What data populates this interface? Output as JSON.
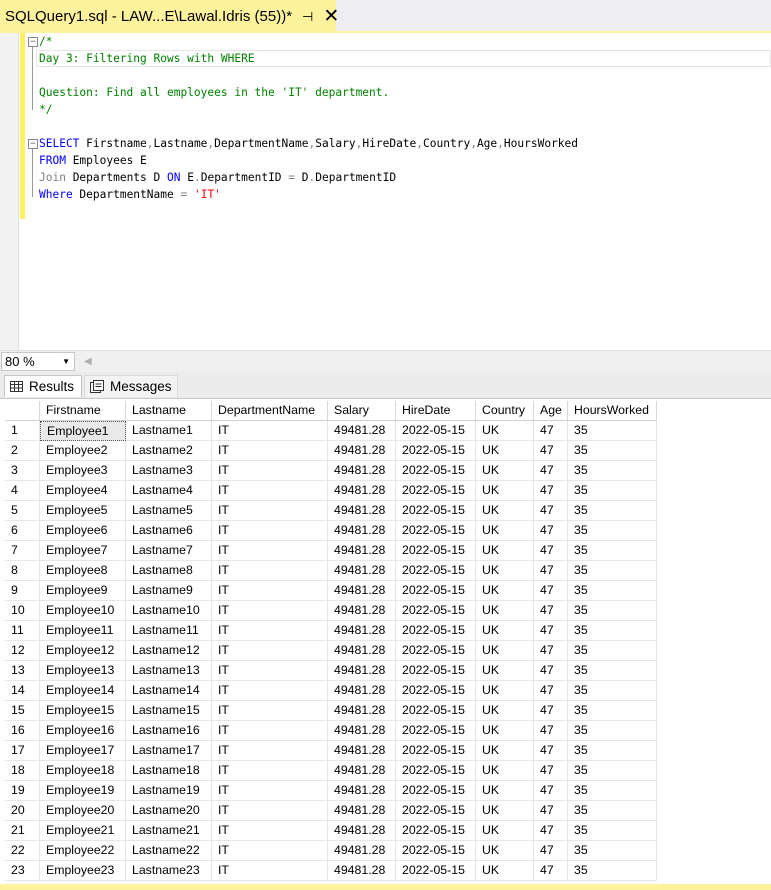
{
  "tab": {
    "title": "SQLQuery1.sql - LAW...E\\Lawal.Idris (55))*",
    "pin": "⊣",
    "close": "✕"
  },
  "editor": {
    "lines": [
      {
        "parts": [
          {
            "t": "/*",
            "c": "cm"
          }
        ]
      },
      {
        "parts": [
          {
            "t": "Day 3: Filtering Rows with WHERE",
            "c": "cm"
          }
        ]
      },
      {
        "parts": [
          {
            "t": "",
            "c": ""
          }
        ]
      },
      {
        "parts": [
          {
            "t": "Question: Find all employees in the 'IT' department.",
            "c": "cm"
          }
        ]
      },
      {
        "parts": [
          {
            "t": "*/",
            "c": "cm"
          }
        ]
      },
      {
        "parts": [
          {
            "t": "",
            "c": ""
          }
        ]
      },
      {
        "parts": [
          {
            "t": "SELECT",
            "c": "kw"
          },
          {
            "t": " Firstname",
            "c": ""
          },
          {
            "t": ",",
            "c": "gr"
          },
          {
            "t": "Lastname",
            "c": ""
          },
          {
            "t": ",",
            "c": "gr"
          },
          {
            "t": "DepartmentName",
            "c": ""
          },
          {
            "t": ",",
            "c": "gr"
          },
          {
            "t": "Salary",
            "c": ""
          },
          {
            "t": ",",
            "c": "gr"
          },
          {
            "t": "HireDate",
            "c": ""
          },
          {
            "t": ",",
            "c": "gr"
          },
          {
            "t": "Country",
            "c": ""
          },
          {
            "t": ",",
            "c": "gr"
          },
          {
            "t": "Age",
            "c": ""
          },
          {
            "t": ",",
            "c": "gr"
          },
          {
            "t": "HoursWorked",
            "c": ""
          }
        ]
      },
      {
        "parts": [
          {
            "t": "FROM",
            "c": "kw"
          },
          {
            "t": " Employees E",
            "c": ""
          }
        ]
      },
      {
        "parts": [
          {
            "t": "Join",
            "c": "gr"
          },
          {
            "t": " Departments D ",
            "c": ""
          },
          {
            "t": "ON",
            "c": "kw"
          },
          {
            "t": " E",
            "c": ""
          },
          {
            "t": ".",
            "c": "gr"
          },
          {
            "t": "DepartmentID ",
            "c": ""
          },
          {
            "t": "=",
            "c": "gr"
          },
          {
            "t": " D",
            "c": ""
          },
          {
            "t": ".",
            "c": "gr"
          },
          {
            "t": "DepartmentID",
            "c": ""
          }
        ]
      },
      {
        "parts": [
          {
            "t": "Where",
            "c": "kw"
          },
          {
            "t": " DepartmentName ",
            "c": ""
          },
          {
            "t": "=",
            "c": "gr"
          },
          {
            "t": " ",
            "c": ""
          },
          {
            "t": "'IT'",
            "c": "str"
          }
        ]
      }
    ]
  },
  "zoom": {
    "value": "80 %"
  },
  "results_tabs": {
    "results": "Results",
    "messages": "Messages"
  },
  "grid": {
    "columns": [
      "",
      "Firstname",
      "Lastname",
      "DepartmentName",
      "Salary",
      "HireDate",
      "Country",
      "Age",
      "HoursWorked"
    ],
    "rows": [
      [
        "1",
        "Employee1",
        "Lastname1",
        "IT",
        "49481.28",
        "2022-05-15",
        "UK",
        "47",
        "35"
      ],
      [
        "2",
        "Employee2",
        "Lastname2",
        "IT",
        "49481.28",
        "2022-05-15",
        "UK",
        "47",
        "35"
      ],
      [
        "3",
        "Employee3",
        "Lastname3",
        "IT",
        "49481.28",
        "2022-05-15",
        "UK",
        "47",
        "35"
      ],
      [
        "4",
        "Employee4",
        "Lastname4",
        "IT",
        "49481.28",
        "2022-05-15",
        "UK",
        "47",
        "35"
      ],
      [
        "5",
        "Employee5",
        "Lastname5",
        "IT",
        "49481.28",
        "2022-05-15",
        "UK",
        "47",
        "35"
      ],
      [
        "6",
        "Employee6",
        "Lastname6",
        "IT",
        "49481.28",
        "2022-05-15",
        "UK",
        "47",
        "35"
      ],
      [
        "7",
        "Employee7",
        "Lastname7",
        "IT",
        "49481.28",
        "2022-05-15",
        "UK",
        "47",
        "35"
      ],
      [
        "8",
        "Employee8",
        "Lastname8",
        "IT",
        "49481.28",
        "2022-05-15",
        "UK",
        "47",
        "35"
      ],
      [
        "9",
        "Employee9",
        "Lastname9",
        "IT",
        "49481.28",
        "2022-05-15",
        "UK",
        "47",
        "35"
      ],
      [
        "10",
        "Employee10",
        "Lastname10",
        "IT",
        "49481.28",
        "2022-05-15",
        "UK",
        "47",
        "35"
      ],
      [
        "11",
        "Employee11",
        "Lastname11",
        "IT",
        "49481.28",
        "2022-05-15",
        "UK",
        "47",
        "35"
      ],
      [
        "12",
        "Employee12",
        "Lastname12",
        "IT",
        "49481.28",
        "2022-05-15",
        "UK",
        "47",
        "35"
      ],
      [
        "13",
        "Employee13",
        "Lastname13",
        "IT",
        "49481.28",
        "2022-05-15",
        "UK",
        "47",
        "35"
      ],
      [
        "14",
        "Employee14",
        "Lastname14",
        "IT",
        "49481.28",
        "2022-05-15",
        "UK",
        "47",
        "35"
      ],
      [
        "15",
        "Employee15",
        "Lastname15",
        "IT",
        "49481.28",
        "2022-05-15",
        "UK",
        "47",
        "35"
      ],
      [
        "16",
        "Employee16",
        "Lastname16",
        "IT",
        "49481.28",
        "2022-05-15",
        "UK",
        "47",
        "35"
      ],
      [
        "17",
        "Employee17",
        "Lastname17",
        "IT",
        "49481.28",
        "2022-05-15",
        "UK",
        "47",
        "35"
      ],
      [
        "18",
        "Employee18",
        "Lastname18",
        "IT",
        "49481.28",
        "2022-05-15",
        "UK",
        "47",
        "35"
      ],
      [
        "19",
        "Employee19",
        "Lastname19",
        "IT",
        "49481.28",
        "2022-05-15",
        "UK",
        "47",
        "35"
      ],
      [
        "20",
        "Employee20",
        "Lastname20",
        "IT",
        "49481.28",
        "2022-05-15",
        "UK",
        "47",
        "35"
      ],
      [
        "21",
        "Employee21",
        "Lastname21",
        "IT",
        "49481.28",
        "2022-05-15",
        "UK",
        "47",
        "35"
      ],
      [
        "22",
        "Employee22",
        "Lastname22",
        "IT",
        "49481.28",
        "2022-05-15",
        "UK",
        "47",
        "35"
      ],
      [
        "23",
        "Employee23",
        "Lastname23",
        "IT",
        "49481.28",
        "2022-05-15",
        "UK",
        "47",
        "35"
      ]
    ]
  },
  "colors": {
    "tab_accent": "#fff29d",
    "keyword": "#0000ff",
    "comment": "#008000",
    "string": "#ff0000"
  },
  "icons": {
    "results": "grid-icon",
    "messages": "messages-icon",
    "pin": "pin-icon",
    "close": "close-icon"
  }
}
